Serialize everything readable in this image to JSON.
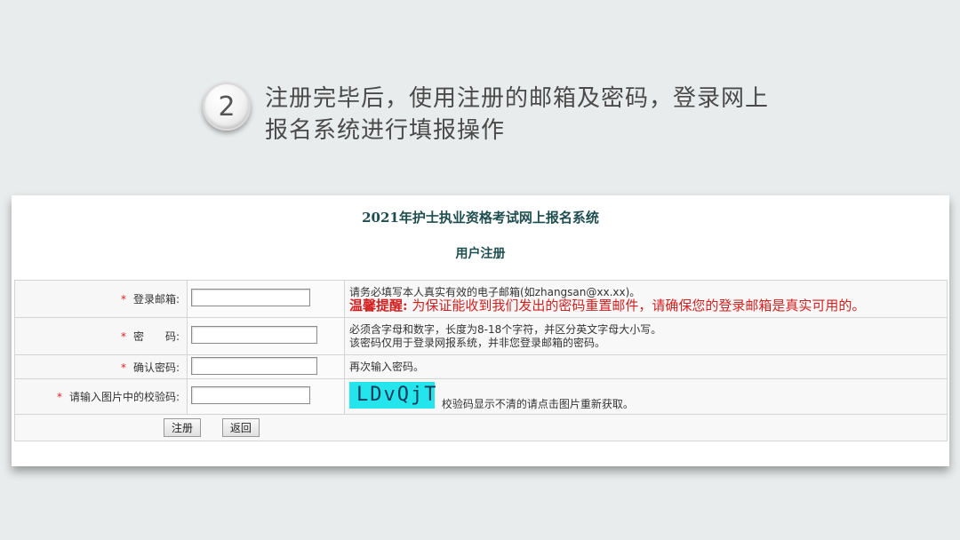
{
  "step": {
    "number": "2",
    "line1": "注册完毕后，使用注册的邮箱及密码，登录网上",
    "line2": "报名系统进行填报操作"
  },
  "form": {
    "system_title": "2021年护士执业资格考试网上报名系统",
    "section_title": "用户注册",
    "required_mark": "*",
    "rows": [
      {
        "label": "登录邮箱:",
        "hint1": "请务必填写本人真实有效的电子邮箱(如zhangsan@xx.xx)。",
        "warn_label": "温馨提醒:",
        "warn_text": "为保证能收到我们发出的密码重置邮件，请确保您的登录邮箱是真实可用的。"
      },
      {
        "label": "密　　码:",
        "hint1": "必须含字母和数字，长度为8-18个字符，并区分英文字母大小写。",
        "hint2": "该密码仅用于登录网报系统，并非您登录邮箱的密码。"
      },
      {
        "label": "确认密码:",
        "hint1": "再次输入密码。"
      },
      {
        "label": "请输入图片中的校验码:",
        "captcha_text": "LDvQjT",
        "hint1": "校验码显示不清的请点击图片重新获取。"
      }
    ],
    "register_button": "注册",
    "back_button": "返回"
  }
}
